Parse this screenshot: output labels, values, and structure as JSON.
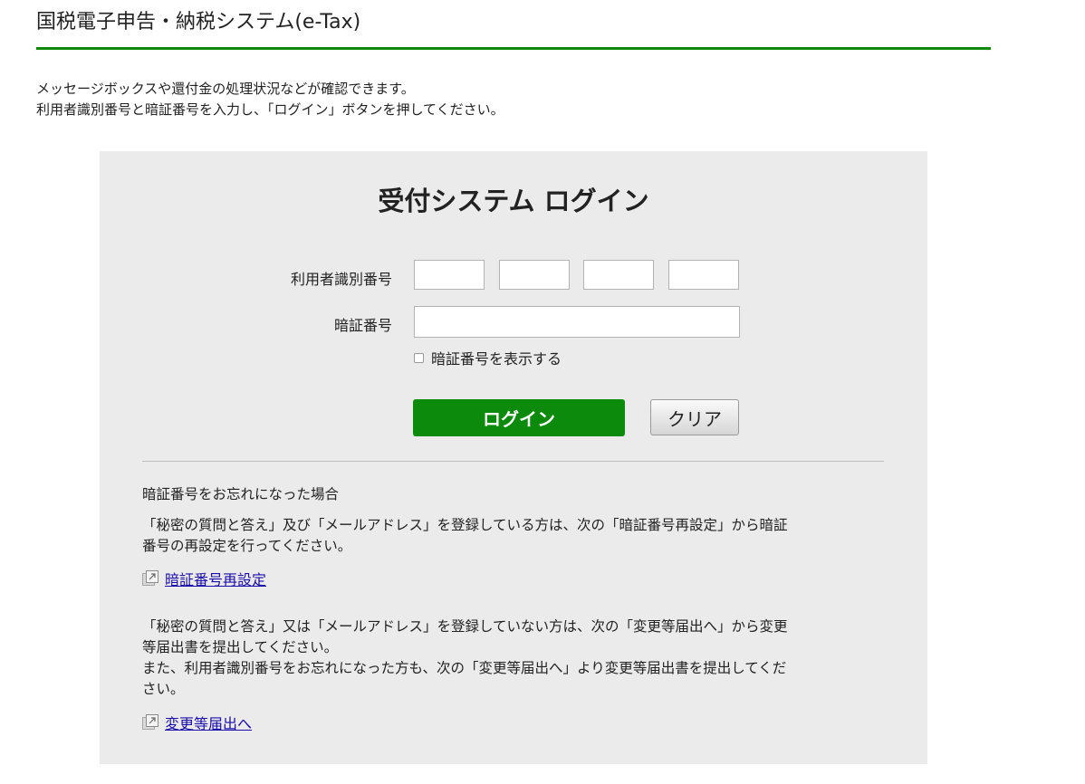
{
  "page": {
    "title": "国税電子申告・納税システム(e-Tax)",
    "intro_lines": [
      "メッセージボックスや還付金の処理状況などが確認できます。",
      "利用者識別番号と暗証番号を入力し、「ログイン」ボタンを押してください。"
    ]
  },
  "login": {
    "heading": "受付システム ログイン",
    "user_id_label": "利用者識別番号",
    "user_id_segments": [
      "",
      "",
      "",
      ""
    ],
    "password_label": "暗証番号",
    "password_value": "",
    "show_password_label": "暗証番号を表示する",
    "show_password_checked": false,
    "login_button": "ログイン",
    "clear_button": "クリア"
  },
  "help": {
    "forgot_title": "暗証番号をお忘れになった場合",
    "registered_lines": [
      "「秘密の質問と答え」及び「メールアドレス」を登録している方は、次の「暗証番号再設定」から暗証",
      "番号の再設定を行ってください。"
    ],
    "reset_link": "暗証番号再設定",
    "unregistered_lines": [
      "「秘密の質問と答え」又は「メールアドレス」を登録していない方は、次の「変更等届出へ」から変更",
      "等届出書を提出してください。",
      "また、利用者識別番号をお忘れになった方も、次の「変更等届出へ」より変更等届出書を提出してくだ",
      "さい。"
    ],
    "change_link": "変更等届出へ"
  },
  "colors": {
    "accent_green": "#0b8a0b",
    "panel_bg": "#ebebeb",
    "link": "#1a0dab"
  },
  "icons": {
    "external_link": "external-link-icon"
  }
}
